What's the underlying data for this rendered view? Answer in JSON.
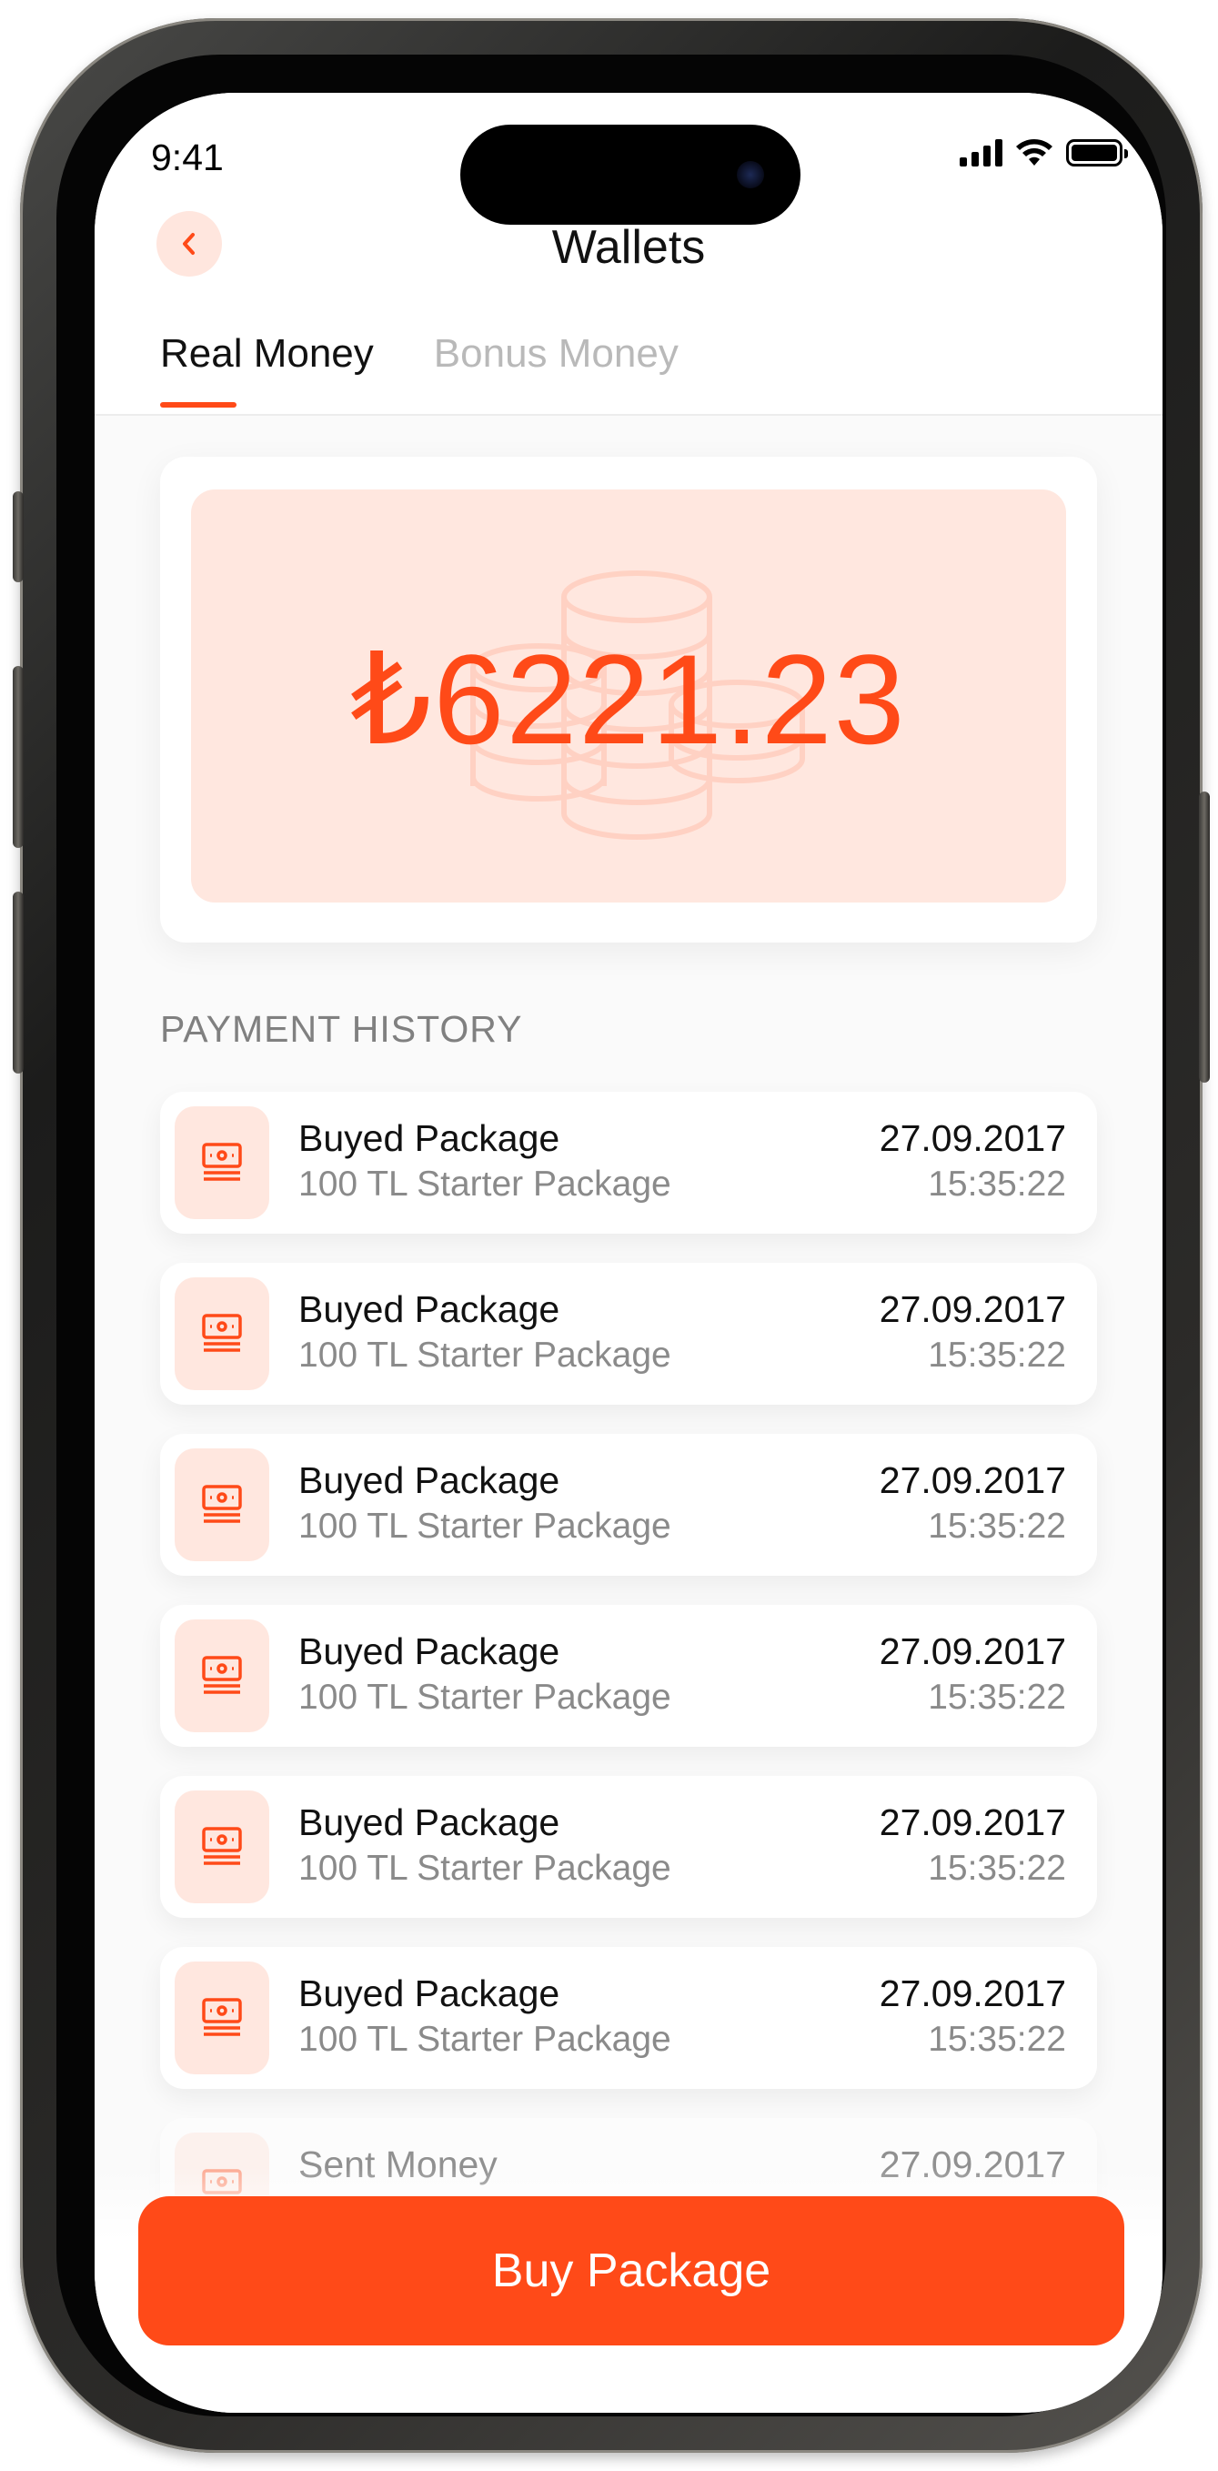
{
  "status_bar": {
    "time": "9:41"
  },
  "header": {
    "title": "Wallets",
    "back_icon": "chevron-left-icon"
  },
  "tabs": [
    {
      "label": "Real Money",
      "active": true
    },
    {
      "label": "Bonus Money",
      "active": false
    }
  ],
  "balance": {
    "amount": "₺6221.23",
    "background_icon": "coins-icon"
  },
  "payment_history": {
    "title": "PAYMENT HISTORY",
    "items": [
      {
        "icon": "banknote-icon",
        "title": "Buyed Package",
        "subtitle": "100 TL Starter Package",
        "date": "27.09.2017",
        "time": "15:35:22"
      },
      {
        "icon": "banknote-icon",
        "title": "Buyed Package",
        "subtitle": "100 TL Starter Package",
        "date": "27.09.2017",
        "time": "15:35:22"
      },
      {
        "icon": "banknote-icon",
        "title": "Buyed Package",
        "subtitle": "100 TL Starter Package",
        "date": "27.09.2017",
        "time": "15:35:22"
      },
      {
        "icon": "banknote-icon",
        "title": "Buyed Package",
        "subtitle": "100 TL Starter Package",
        "date": "27.09.2017",
        "time": "15:35:22"
      },
      {
        "icon": "banknote-icon",
        "title": "Buyed Package",
        "subtitle": "100 TL Starter Package",
        "date": "27.09.2017",
        "time": "15:35:22"
      },
      {
        "icon": "banknote-icon",
        "title": "Buyed Package",
        "subtitle": "100 TL Starter Package",
        "date": "27.09.2017",
        "time": "15:35:22"
      },
      {
        "icon": "banknote-icon",
        "title": "Sent Money",
        "subtitle": "",
        "date": "27.09.2017",
        "time": ""
      }
    ]
  },
  "actions": {
    "buy_package_label": "Buy Package"
  },
  "colors": {
    "accent": "#ff4a18",
    "accent_soft": "#ffe7df"
  }
}
